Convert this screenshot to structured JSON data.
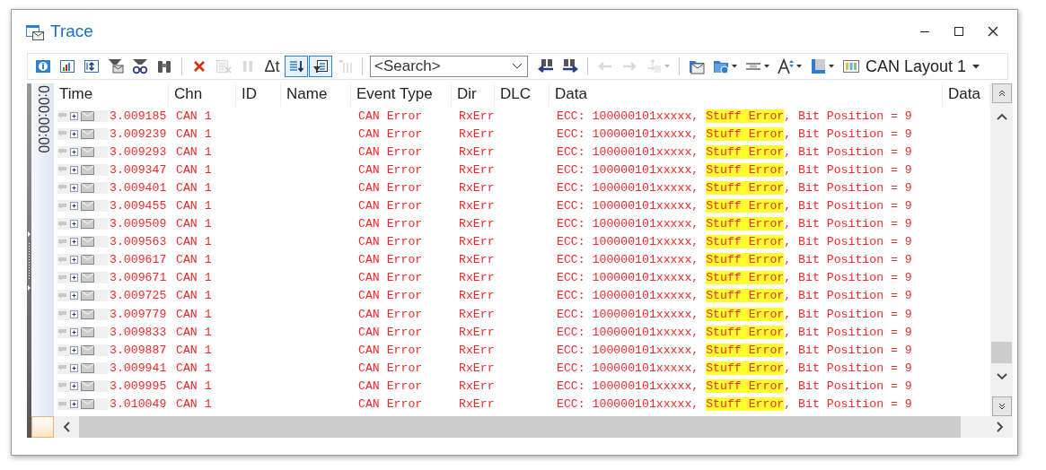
{
  "window": {
    "title": "Trace"
  },
  "toolbar": {
    "buttons": [
      {
        "disabled": false,
        "on": false
      },
      {
        "disabled": false,
        "on": false
      },
      {
        "disabled": false,
        "on": false
      },
      {
        "disabled": false,
        "on": false
      },
      {
        "disabled": false,
        "on": false
      },
      {
        "disabled": false,
        "on": false
      },
      {
        "disabled": false,
        "on": false
      },
      {
        "disabled": true,
        "on": false
      },
      {
        "disabled": true,
        "on": false
      },
      {
        "disabled": false,
        "on": false,
        "label": "Δt"
      },
      {
        "disabled": false,
        "on": true
      },
      {
        "disabled": false,
        "on": true
      },
      {
        "disabled": true,
        "on": false
      }
    ],
    "search": {
      "placeholder": "<Search>"
    },
    "find_buttons": [
      {
        "disabled": false
      },
      {
        "disabled": false
      },
      {
        "disabled": true
      },
      {
        "disabled": true
      },
      {
        "disabled": true
      }
    ],
    "view_buttons": [
      {
        "disabled": false
      },
      {
        "disabled": false
      },
      {
        "disabled": false
      },
      {
        "disabled": false
      },
      {
        "disabled": false
      }
    ],
    "layout": {
      "value": "CAN Layout 1"
    }
  },
  "side_strip": {
    "time_label": "0:00:00:00"
  },
  "table": {
    "columns": [
      "Time",
      "Chn",
      "ID",
      "Name",
      "Event Type",
      "Dir",
      "DLC",
      "Data",
      "Data"
    ],
    "rows": [
      {
        "expanded": false,
        "time": "3.009185",
        "chn": "CAN 1",
        "event_type": "CAN Error",
        "dir": "RxErr",
        "data": {
          "before": "ECC: 100000101xxxxx, ",
          "highlight": "Stuff Error",
          "after": ", Bit Position = 9"
        }
      },
      {
        "expanded": false,
        "time": "3.009239",
        "chn": "CAN 1",
        "event_type": "CAN Error",
        "dir": "RxErr",
        "data": {
          "before": "ECC: 100000101xxxxx, ",
          "highlight": "Stuff Error",
          "after": ", Bit Position = 9"
        }
      },
      {
        "expanded": false,
        "time": "3.009293",
        "chn": "CAN 1",
        "event_type": "CAN Error",
        "dir": "RxErr",
        "data": {
          "before": "ECC: 100000101xxxxx, ",
          "highlight": "Stuff Error",
          "after": ", Bit Position = 9"
        }
      },
      {
        "expanded": false,
        "time": "3.009347",
        "chn": "CAN 1",
        "event_type": "CAN Error",
        "dir": "RxErr",
        "data": {
          "before": "ECC: 100000101xxxxx, ",
          "highlight": "Stuff Error",
          "after": ", Bit Position = 9"
        }
      },
      {
        "expanded": false,
        "time": "3.009401",
        "chn": "CAN 1",
        "event_type": "CAN Error",
        "dir": "RxErr",
        "data": {
          "before": "ECC: 100000101xxxxx, ",
          "highlight": "Stuff Error",
          "after": ", Bit Position = 9"
        }
      },
      {
        "expanded": false,
        "time": "3.009455",
        "chn": "CAN 1",
        "event_type": "CAN Error",
        "dir": "RxErr",
        "data": {
          "before": "ECC: 100000101xxxxx, ",
          "highlight": "Stuff Error",
          "after": ", Bit Position = 9"
        }
      },
      {
        "expanded": false,
        "time": "3.009509",
        "chn": "CAN 1",
        "event_type": "CAN Error",
        "dir": "RxErr",
        "data": {
          "before": "ECC: 100000101xxxxx, ",
          "highlight": "Stuff Error",
          "after": ", Bit Position = 9"
        }
      },
      {
        "expanded": false,
        "time": "3.009563",
        "chn": "CAN 1",
        "event_type": "CAN Error",
        "dir": "RxErr",
        "data": {
          "before": "ECC: 100000101xxxxx, ",
          "highlight": "Stuff Error",
          "after": ", Bit Position = 9"
        }
      },
      {
        "expanded": false,
        "time": "3.009617",
        "chn": "CAN 1",
        "event_type": "CAN Error",
        "dir": "RxErr",
        "data": {
          "before": "ECC: 100000101xxxxx, ",
          "highlight": "Stuff Error",
          "after": ", Bit Position = 9"
        }
      },
      {
        "expanded": false,
        "time": "3.009671",
        "chn": "CAN 1",
        "event_type": "CAN Error",
        "dir": "RxErr",
        "data": {
          "before": "ECC: 100000101xxxxx, ",
          "highlight": "Stuff Error",
          "after": ", Bit Position = 9"
        }
      },
      {
        "expanded": false,
        "time": "3.009725",
        "chn": "CAN 1",
        "event_type": "CAN Error",
        "dir": "RxErr",
        "data": {
          "before": "ECC: 100000101xxxxx, ",
          "highlight": "Stuff Error",
          "after": ", Bit Position = 9"
        }
      },
      {
        "expanded": false,
        "time": "3.009779",
        "chn": "CAN 1",
        "event_type": "CAN Error",
        "dir": "RxErr",
        "data": {
          "before": "ECC: 100000101xxxxx, ",
          "highlight": "Stuff Error",
          "after": ", Bit Position = 9"
        }
      },
      {
        "expanded": false,
        "time": "3.009833",
        "chn": "CAN 1",
        "event_type": "CAN Error",
        "dir": "RxErr",
        "data": {
          "before": "ECC: 100000101xxxxx, ",
          "highlight": "Stuff Error",
          "after": ", Bit Position = 9"
        }
      },
      {
        "expanded": false,
        "time": "3.009887",
        "chn": "CAN 1",
        "event_type": "CAN Error",
        "dir": "RxErr",
        "data": {
          "before": "ECC: 100000101xxxxx, ",
          "highlight": "Stuff Error",
          "after": ", Bit Position = 9"
        }
      },
      {
        "expanded": false,
        "time": "3.009941",
        "chn": "CAN 1",
        "event_type": "CAN Error",
        "dir": "RxErr",
        "data": {
          "before": "ECC: 100000101xxxxx, ",
          "highlight": "Stuff Error",
          "after": ", Bit Position = 9"
        }
      },
      {
        "expanded": false,
        "time": "3.009995",
        "chn": "CAN 1",
        "event_type": "CAN Error",
        "dir": "RxErr",
        "data": {
          "before": "ECC: 100000101xxxxx, ",
          "highlight": "Stuff Error",
          "after": ", Bit Position = 9"
        }
      },
      {
        "expanded": false,
        "time": "3.010049",
        "chn": "CAN 1",
        "event_type": "CAN Error",
        "dir": "RxErr",
        "data": {
          "before": "ECC: 100000101xxxxx, ",
          "highlight": "Stuff Error",
          "after": ", Bit Position = 9"
        }
      }
    ]
  }
}
